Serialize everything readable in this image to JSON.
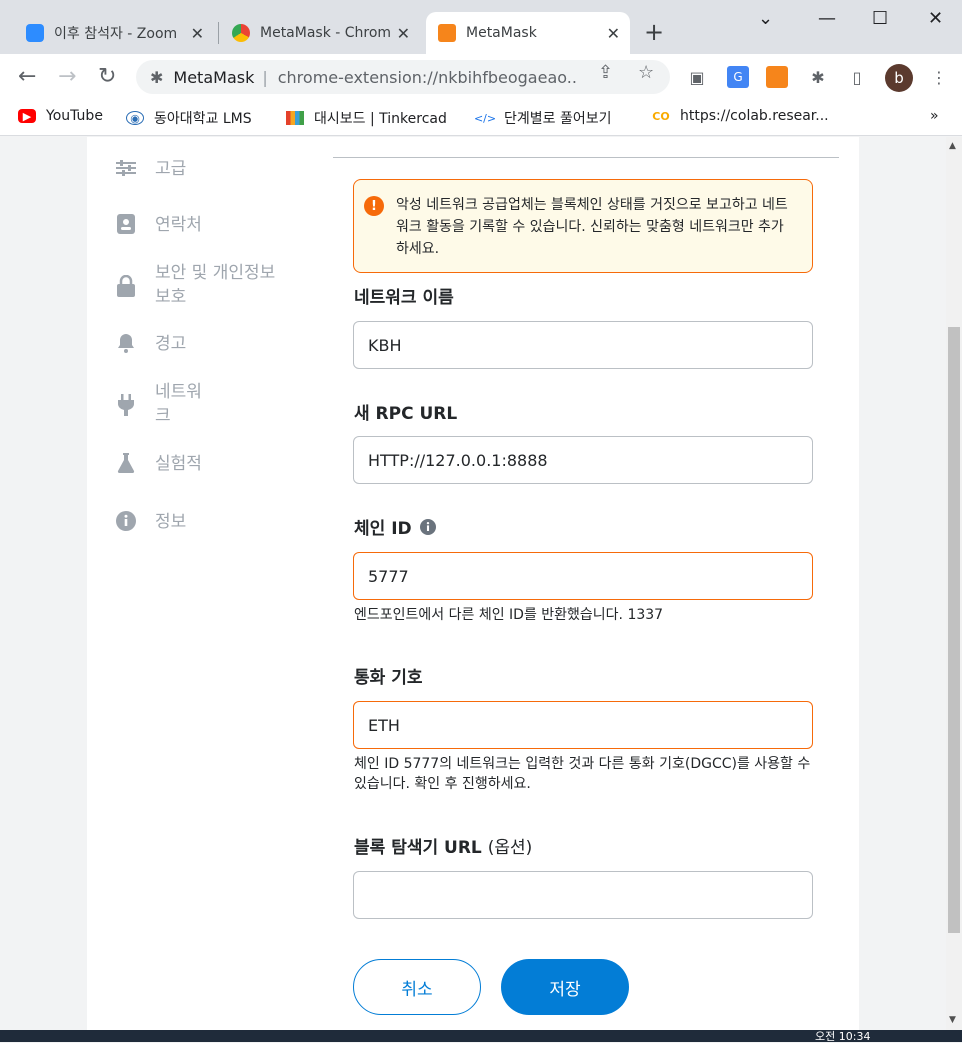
{
  "browser": {
    "tabs": [
      {
        "title": "이후 참석자 - Zoom"
      },
      {
        "title": "MetaMask - Chrome"
      },
      {
        "title": "MetaMask"
      }
    ],
    "address": {
      "site": "MetaMask",
      "url": "chrome-extension://nkbihfbeogaeao..."
    },
    "profile_initial": "b",
    "bookmarks": [
      {
        "label": "YouTube"
      },
      {
        "label": "동아대학교 LMS"
      },
      {
        "label": "대시보드 | Tinkercad"
      },
      {
        "label": "단계별로 풀어보기"
      },
      {
        "label": "https://colab.resear..."
      }
    ],
    "more_bookmarks": "»"
  },
  "sidebar": {
    "items": [
      {
        "label": "고급"
      },
      {
        "label": "연락처"
      },
      {
        "label": "보안 및 개인정보\n보호"
      },
      {
        "label": "경고"
      },
      {
        "label": "네트워\n크"
      },
      {
        "label": "실험적"
      },
      {
        "label": "정보"
      }
    ]
  },
  "form": {
    "warning": "악성 네트워크 공급업체는 블록체인 상태를 거짓으로 보고하고 네트워크 활동을 기록할 수 있습니다. 신뢰하는 맞춤형 네트워크만 추가하세요.",
    "network_name_label": "네트워크 이름",
    "network_name_value": "KBH",
    "rpc_label": "새 RPC URL",
    "rpc_value": "HTTP://127.0.0.1:8888",
    "chain_id_label": "체인 ID",
    "chain_id_value": "5777",
    "chain_id_error": "엔드포인트에서 다른 체인 ID를 반환했습니다. 1337",
    "symbol_label": "통화 기호",
    "symbol_value": "ETH",
    "symbol_warning": "체인 ID 5777의 네트워크는 입력한 것과 다른 통화 기호(DGCC)를 사용할 수 있습니다. 확인 후 진행하세요.",
    "explorer_label": "블록 탐색기 URL",
    "explorer_optional": "(옵션)",
    "explorer_value": "",
    "cancel_label": "취소",
    "save_label": "저장"
  },
  "taskbar": {
    "clock": "오전 10:34"
  },
  "colors": {
    "accent": "#037dd6",
    "warning": "#f66a0a",
    "warning_bg": "#fefae8"
  }
}
